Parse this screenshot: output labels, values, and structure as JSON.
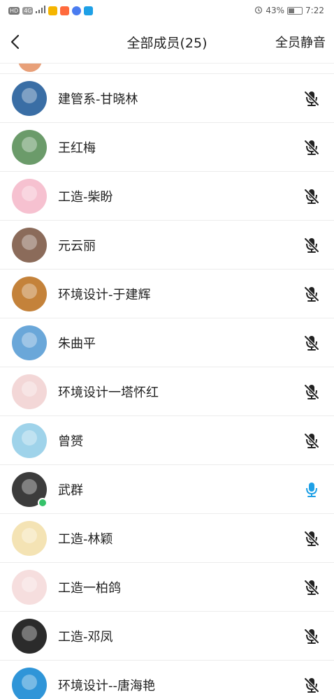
{
  "status_bar": {
    "left_chips": [
      "HD",
      "4G"
    ],
    "battery": "43%",
    "time": "7:22"
  },
  "header": {
    "title": "全部成员(25)",
    "mute_all": "全员静音"
  },
  "members": [
    {
      "name": "建管系-甘晓林",
      "avatar_color": "#3a6ea5",
      "mic": "muted"
    },
    {
      "name": "王红梅",
      "avatar_color": "#6b9b6a",
      "mic": "muted"
    },
    {
      "name": "工造-柴盼",
      "avatar_color": "#f6c1d0",
      "mic": "muted"
    },
    {
      "name": "元云丽",
      "avatar_color": "#8b6b5a",
      "mic": "muted"
    },
    {
      "name": "环境设计-于建辉",
      "avatar_color": "#c4823a",
      "mic": "muted"
    },
    {
      "name": "朱曲平",
      "avatar_color": "#6aa7d9",
      "mic": "muted"
    },
    {
      "name": "环境设计一塔怀红",
      "avatar_color": "#f3d7d7",
      "mic": "muted"
    },
    {
      "name": "曾赟",
      "avatar_color": "#9fd3ea",
      "mic": "muted"
    },
    {
      "name": "武群",
      "avatar_color": "#3c3c3c",
      "mic": "active"
    },
    {
      "name": "工造-林颖",
      "avatar_color": "#f4e3b4",
      "mic": "muted"
    },
    {
      "name": "工造一柏鸽",
      "avatar_color": "#f6dede",
      "mic": "muted"
    },
    {
      "name": "工造-邓凤",
      "avatar_color": "#2b2b2b",
      "mic": "muted"
    },
    {
      "name": "环境设计--唐海艳",
      "avatar_color": "#2f95d8",
      "mic": "muted"
    }
  ],
  "colors": {
    "mic_muted": "#222222",
    "mic_active": "#1ea0e6",
    "divider": "#ececec"
  }
}
